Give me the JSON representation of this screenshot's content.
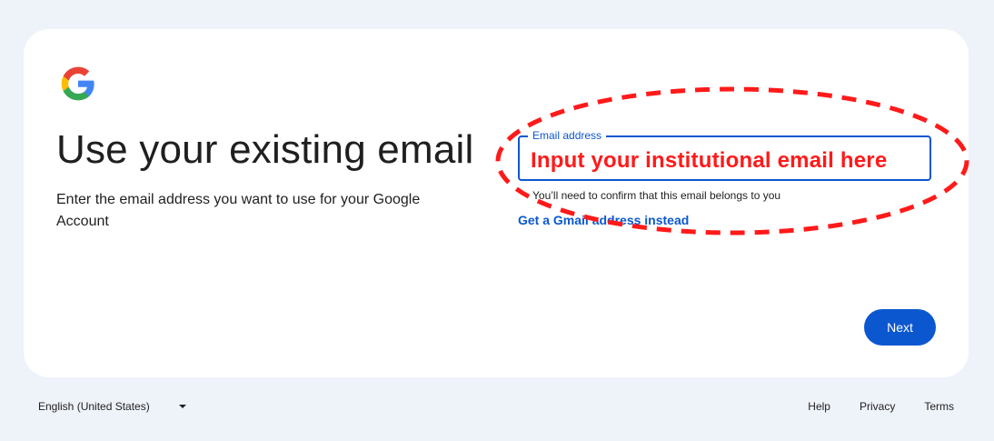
{
  "page": {
    "title": "Use your existing email",
    "subtitle": "Enter the email address you want to use for your Google Account"
  },
  "email_field": {
    "label": "Email address",
    "value": "Input your institutional email here",
    "helper_text": "You’ll need to confirm that this email belongs to you"
  },
  "links": {
    "gmail_instead": "Get a Gmail address instead"
  },
  "actions": {
    "next_label": "Next"
  },
  "footer": {
    "language": "English (United States)",
    "help": "Help",
    "privacy": "Privacy",
    "terms": "Terms"
  },
  "colors": {
    "accent": "#0b57d0",
    "annotation": "#ff1a1a",
    "background": "#eef2f9"
  }
}
